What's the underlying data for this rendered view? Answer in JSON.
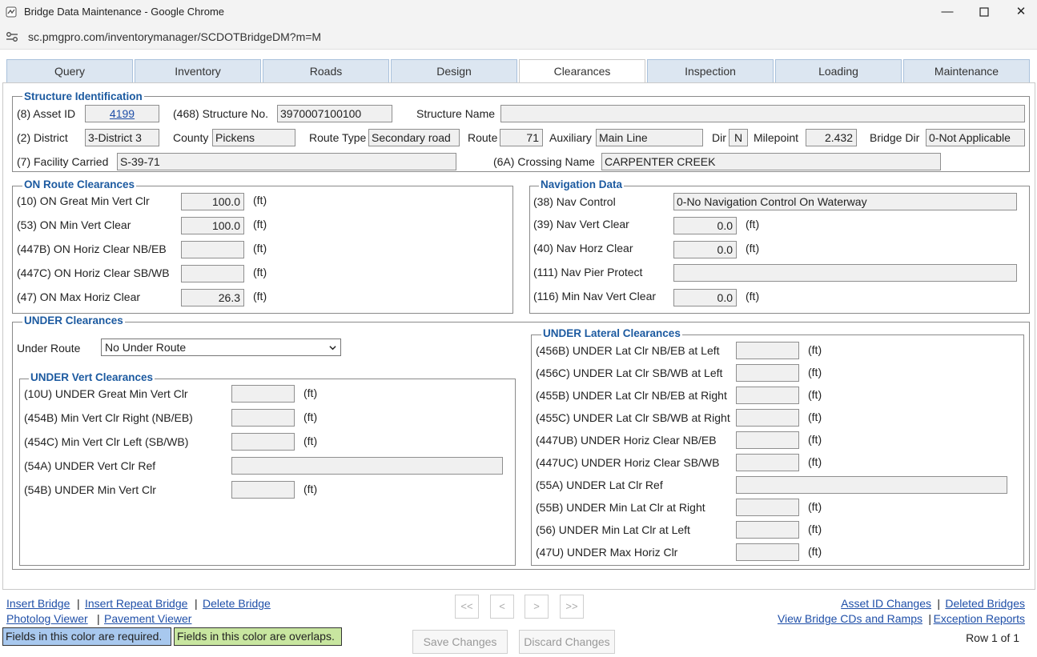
{
  "window": {
    "title": "Bridge Data Maintenance - Google Chrome",
    "url": "sc.pmgpro.com/inventorymanager/SCDOTBridgeDM?m=M"
  },
  "tabs": [
    "Query",
    "Inventory",
    "Roads",
    "Design",
    "Clearances",
    "Inspection",
    "Loading",
    "Maintenance"
  ],
  "active_tab": "Clearances",
  "structure_id": {
    "legend": "Structure Identification",
    "asset_id_label": "(8) Asset ID",
    "asset_id": "4199",
    "structure_no_label": "(468) Structure No.",
    "structure_no": "3970007100100",
    "structure_name_label": "Structure Name",
    "structure_name": "",
    "district_label": "(2) District",
    "district": "3-District 3",
    "county_label": "County",
    "county": "Pickens",
    "route_type_label": "Route Type",
    "route_type": "Secondary road",
    "route_label": "Route",
    "route": "71",
    "auxiliary_label": "Auxiliary",
    "auxiliary": "Main Line",
    "dir_label": "Dir",
    "dir": "N",
    "milepoint_label": "Milepoint",
    "milepoint": "2.432",
    "bridge_dir_label": "Bridge Dir",
    "bridge_dir": "0-Not Applicable",
    "facility_label": "(7) Facility Carried",
    "facility": "S-39-71",
    "crossing_label": "(6A) Crossing Name",
    "crossing": "CARPENTER CREEK"
  },
  "on_route": {
    "legend": "ON Route Clearances",
    "unit": "(ft)",
    "rows": [
      {
        "label": "(10) ON Great Min Vert Clr",
        "value": "100.0"
      },
      {
        "label": "(53) ON Min Vert Clear",
        "value": "100.0"
      },
      {
        "label": "(447B) ON Horiz Clear NB/EB",
        "value": ""
      },
      {
        "label": "(447C) ON Horiz Clear SB/WB",
        "value": ""
      },
      {
        "label": "(47) ON Max Horiz Clear",
        "value": "26.3"
      }
    ]
  },
  "navigation": {
    "legend": "Navigation Data",
    "unit": "(ft)",
    "nav_control_label": "(38) Nav Control",
    "nav_control": "0-No Navigation Control On Waterway",
    "nav_vert_label": "(39) Nav Vert Clear",
    "nav_vert": "0.0",
    "nav_horz_label": "(40) Nav Horz Clear",
    "nav_horz": "0.0",
    "nav_pier_label": "(111) Nav Pier Protect",
    "nav_pier": "",
    "min_nav_label": "(116) Min Nav Vert Clear",
    "min_nav": "0.0"
  },
  "under": {
    "legend": "UNDER Clearances",
    "under_route_label": "Under Route",
    "under_route": "No Under Route",
    "unit": "(ft)",
    "vert_legend": "UNDER Vert Clearances",
    "vert_rows": [
      {
        "label": "(10U) UNDER Great Min Vert Clr",
        "value": ""
      },
      {
        "label": "(454B) Min Vert Clr Right (NB/EB)",
        "value": ""
      },
      {
        "label": "(454C) Min Vert Clr Left (SB/WB)",
        "value": ""
      },
      {
        "label": "(54A) UNDER Vert Clr Ref",
        "value": ""
      },
      {
        "label": "(54B) UNDER Min Vert Clr",
        "value": ""
      }
    ],
    "lat_legend": "UNDER Lateral Clearances",
    "lat_rows": [
      {
        "label": "(456B) UNDER Lat Clr NB/EB at Left",
        "value": ""
      },
      {
        "label": "(456C) UNDER Lat Clr SB/WB at Left",
        "value": ""
      },
      {
        "label": "(455B) UNDER Lat Clr NB/EB at Right",
        "value": ""
      },
      {
        "label": "(455C) UNDER Lat Clr SB/WB at Right",
        "value": ""
      },
      {
        "label": "(447UB) UNDER Horiz Clear NB/EB",
        "value": ""
      },
      {
        "label": "(447UC) UNDER Horiz Clear SB/WB",
        "value": ""
      },
      {
        "label": "(55A) UNDER Lat Clr Ref",
        "value": ""
      },
      {
        "label": "(55B) UNDER Min Lat Clr at Right",
        "value": ""
      },
      {
        "label": "(56) UNDER Min Lat Clr at Left",
        "value": ""
      },
      {
        "label": "(47U) UNDER Max Horiz Clr",
        "value": ""
      }
    ]
  },
  "footer": {
    "insert_bridge": "Insert Bridge",
    "insert_repeat_bridge": "Insert Repeat Bridge",
    "delete_bridge": "Delete Bridge",
    "photolog_viewer": "Photolog Viewer",
    "pavement_viewer": "Pavement Viewer",
    "sep": "|",
    "nav_first": "<<",
    "nav_prev": "<",
    "nav_next": ">",
    "nav_last": ">>",
    "save_changes": "Save Changes",
    "discard_changes": "Discard Changes",
    "required_legend": "Fields in this color are required.",
    "overlap_legend": "Fields in this color are overlaps.",
    "asset_id_changes": "Asset ID Changes",
    "deleted_bridges": "Deleted Bridges",
    "view_cds": "View Bridge CDs and Ramps",
    "exception_reports": "Exception Reports",
    "row_status": "Row 1 of 1"
  },
  "colors": {
    "required": "#a8c8ee",
    "overlap": "#c8e6a0",
    "tab": "#dce6f1",
    "legend": "#1c5aa0"
  }
}
